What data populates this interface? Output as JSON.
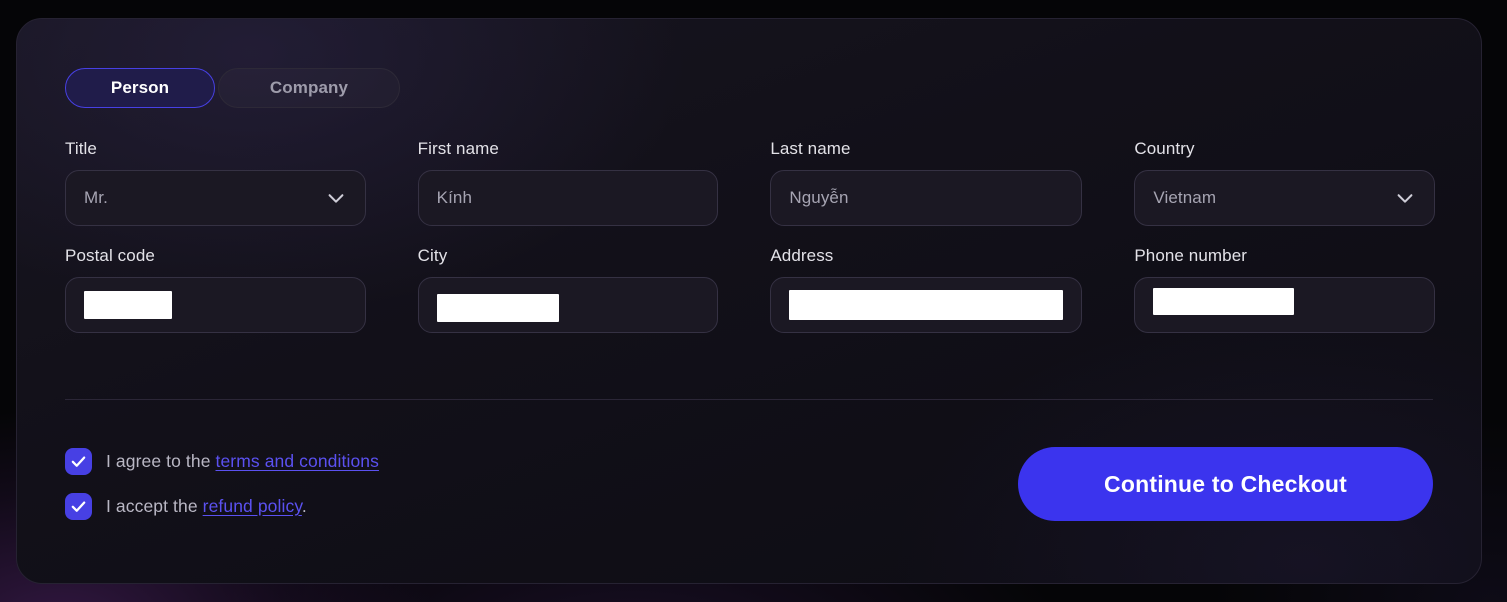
{
  "colors": {
    "accent": "#4740e4",
    "cta": "#3b34ee",
    "link": "#5b51f0",
    "card_bg": "#17151f",
    "field_bg": "#1b1823",
    "field_border": "#353143",
    "label": "#e3e2e8",
    "value": "#a6a4b2",
    "redaction": "#ffffff"
  },
  "entity_type": {
    "options": [
      "Person",
      "Company"
    ],
    "selected": "Person",
    "person_label": "Person",
    "company_label": "Company"
  },
  "form": {
    "fields": [
      {
        "name": "title",
        "label": "Title",
        "type": "select",
        "value": "Mr.",
        "redacted": false,
        "icon": "chevron-down-icon"
      },
      {
        "name": "first-name",
        "label": "First name",
        "type": "text",
        "value": "Kính",
        "redacted": false
      },
      {
        "name": "last-name",
        "label": "Last name",
        "type": "text",
        "value": "Nguyễn",
        "redacted": false
      },
      {
        "name": "country",
        "label": "Country",
        "type": "select",
        "value": "Vietnam",
        "redacted": false,
        "icon": "chevron-down-icon"
      },
      {
        "name": "postal-code",
        "label": "Postal code",
        "type": "text",
        "value": "",
        "redacted": true
      },
      {
        "name": "city",
        "label": "City",
        "type": "text",
        "value": "",
        "redacted": true
      },
      {
        "name": "address",
        "label": "Address",
        "type": "text",
        "value": "",
        "redacted": true
      },
      {
        "name": "phone-number",
        "label": "Phone number",
        "type": "text",
        "value": "",
        "redacted": true
      }
    ]
  },
  "consents": [
    {
      "name": "terms",
      "checked": true,
      "prefix": "I agree to the ",
      "link": "terms and conditions",
      "suffix": ""
    },
    {
      "name": "refund",
      "checked": true,
      "prefix": "I accept the ",
      "link": "refund policy",
      "suffix": "."
    }
  ],
  "cta": {
    "label": "Continue to Checkout"
  }
}
